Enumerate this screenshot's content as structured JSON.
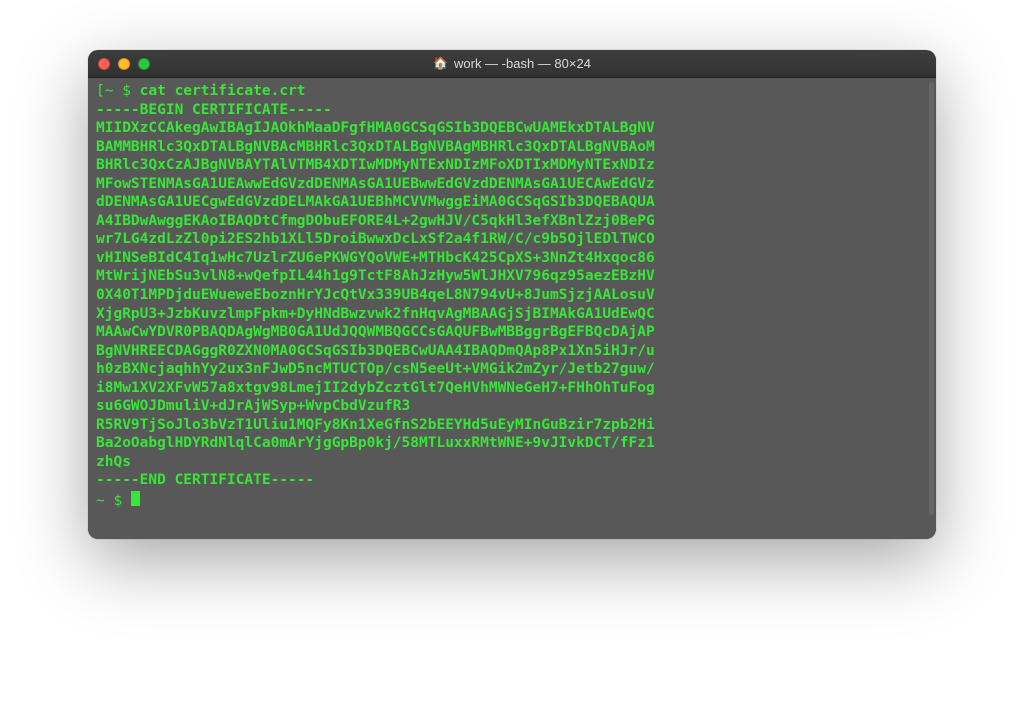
{
  "window": {
    "title_icon": "🏠",
    "title": "work — -bash — 80×24"
  },
  "colors": {
    "terminal_bg": "#585858",
    "terminal_fg": "#37e637",
    "titlebar_text": "#d9d9d9"
  },
  "traffic_lights": {
    "red": "#ff5f57",
    "yellow": "#febc2e",
    "green": "#28c840"
  },
  "terminal": {
    "prompt1_prefix": "[~ $ ",
    "command1": "cat certificate.crt",
    "lines": [
      "-----BEGIN CERTIFICATE-----",
      "MIIDXzCCAkegAwIBAgIJAOkhMaaDFgfHMA0GCSqGSIb3DQEBCwUAMEkxDTALBgNV",
      "BAMMBHRlc3QxDTALBgNVBAcMBHRlc3QxDTALBgNVBAgMBHRlc3QxDTALBgNVBAoM",
      "BHRlc3QxCzAJBgNVBAYTAlVTMB4XDTIwMDMyNTExNDIzMFoXDTIxMDMyNTExNDIz",
      "MFowSTENMAsGA1UEAwwEdGVzdDENMAsGA1UEBwwEdGVzdDENMAsGA1UECAwEdGVz",
      "dDENMAsGA1UECgwEdGVzdDELMAkGA1UEBhMCVVMwggEiMA0GCSqGSIb3DQEBAQUA",
      "A4IBDwAwggEKAoIBAQDtCfmgDObuEFORE4L+2gwHJV/C5qkHl3efXBnlZzj0BePG",
      "wr7LG4zdLzZl0pi2ES2hb1XLl5DroiBwwxDcLxSf2a4f1RW/C/c9b5OjlEDlTWCO",
      "vHINSeBIdC4Iq1wHc7UzlrZU6ePKWGYQoVWE+MTHbcK425CpXS+3NnZt4Hxqoc86",
      "MtWrijNEbSu3vlN8+wQefpIL44h1g9TctF8AhJzHyw5WlJHXV796qz95aezEBzHV",
      "0X40T1MPDjduEWueweEboznHrYJcQtVx339UB4qeL8N794vU+8JumSjzjAALosuV",
      "XjgRpU3+JzbKuvzlmpFpkm+DyHNdBwzvwk2fnHqvAgMBAAGjSjBIMAkGA1UdEwQC",
      "MAAwCwYDVR0PBAQDAgWgMB0GA1UdJQQWMBQGCCsGAQUFBwMBBggrBgEFBQcDAjAP",
      "BgNVHREECDAGggR0ZXN0MA0GCSqGSIb3DQEBCwUAA4IBAQDmQAp8Px1Xn5iHJr/u",
      "h0zBXNcjaqhhYy2ux3nFJwD5ncMTUCTOp/csN5eeUt+VMGik2mZyr/Jetb27guw/",
      "i8Mw1XV2XFvW57a8xtgv98LmejII2dybZcztGlt7QeHVhMWNeGeH7+FHhOhTuFog",
      "su6GWOJDmuliV+dJrAjWSyp+WvpCbdVzufR3",
      "R5RV9TjSoJlo3bVzT1Uliu1MQFy8Kn1XeGfnS2bEEYHd5uEyMInGuBzir7zpb2Hi",
      "Ba2oOabglHDYRdNlqlCa0mArYjgGpBp0kj/58MTLuxxRMtWNE+9vJIvkDCT/fFz1",
      "zhQs",
      "-----END CERTIFICATE-----"
    ],
    "prompt2_prefix": "~ $ "
  }
}
